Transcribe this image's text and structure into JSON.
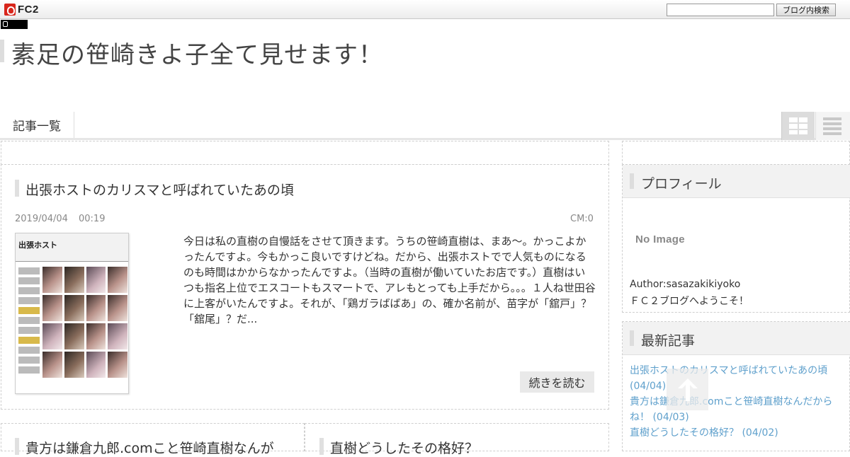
{
  "fc2bar": {
    "logo_text": "FC2",
    "search_placeholder": "",
    "search_button": "ブログ内検索"
  },
  "header": {
    "blog_title": "素足の笹崎きよ子全て見せます！"
  },
  "nav": {
    "items": [
      "記事一覧"
    ],
    "view_icons": [
      "grid-view-icon",
      "list-view-icon"
    ]
  },
  "main": {
    "post": {
      "title": "出張ホストのカリスマと呼ばれていたあの頃",
      "date": "2019/04/04",
      "time": "00:19",
      "comments": "CM:0",
      "thumb_header": "出張ホスト",
      "excerpt": "今日は私の直樹の自慢話をさせて頂きます。うちの笹崎直樹は、まあ〜。かっこよかったんですよ。今もかっこ良いですけどね。だから、出張ホストでで人気ものになるのも時間はかからなかったんですよ。（当時の直樹が働いていたお店です。）直樹はいつも指名上位でエスコートもスマートで、アレもとっても上手だから。。。１人ね世田谷に上客がいたんですよ。それが、「鶏ガラばばあ」の、確か名前が、苗字が「舘戸」？「舘尾」？だ...",
      "more_label": "続きを読む"
    },
    "next_posts": [
      {
        "title": "貴方は鎌倉九郎.comこと笹崎直樹なんが"
      },
      {
        "title": "直樹どうしたその格好？"
      }
    ]
  },
  "sidebar": {
    "profile": {
      "heading": "プロフィール",
      "no_image": "No Image",
      "author": "Author:sasazakikiyoko",
      "welcome": "ＦＣ２ブログへようこそ！"
    },
    "recent": {
      "heading": "最新記事",
      "items": [
        "出張ホストのカリスマと呼ばれていたあの頃 (04/04)",
        "貴方は鎌倉九郎.comこと笹崎直樹なんだからね！ (04/03)",
        "直樹どうしたその格好？ (04/02)"
      ]
    }
  },
  "icons": {
    "totop": "arrow-up-icon"
  },
  "colors": {
    "link": "#5fa0cc",
    "fc2_red": "#d8261c"
  }
}
